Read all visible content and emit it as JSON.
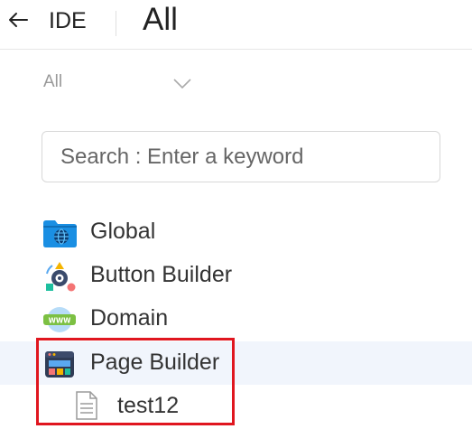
{
  "header": {
    "back_icon": "arrow-left-icon",
    "section_label": "IDE",
    "title": "All"
  },
  "filter": {
    "selected": "All",
    "chevron_icon": "chevron-down-icon"
  },
  "search": {
    "placeholder": "Search : Enter a keyword",
    "value": ""
  },
  "tree": {
    "items": [
      {
        "label": "Global",
        "icon": "globe-folder-icon"
      },
      {
        "label": "Button Builder",
        "icon": "button-builder-icon"
      },
      {
        "label": "Domain",
        "icon": "domain-www-icon"
      },
      {
        "label": "Page Builder",
        "icon": "page-builder-icon",
        "selected": true,
        "children": [
          {
            "label": "test12",
            "icon": "document-icon"
          }
        ]
      }
    ]
  },
  "colors": {
    "selected_row": "#f1f5fc",
    "highlight_border": "#e0161f",
    "accent_blue": "#1a8fe3"
  }
}
